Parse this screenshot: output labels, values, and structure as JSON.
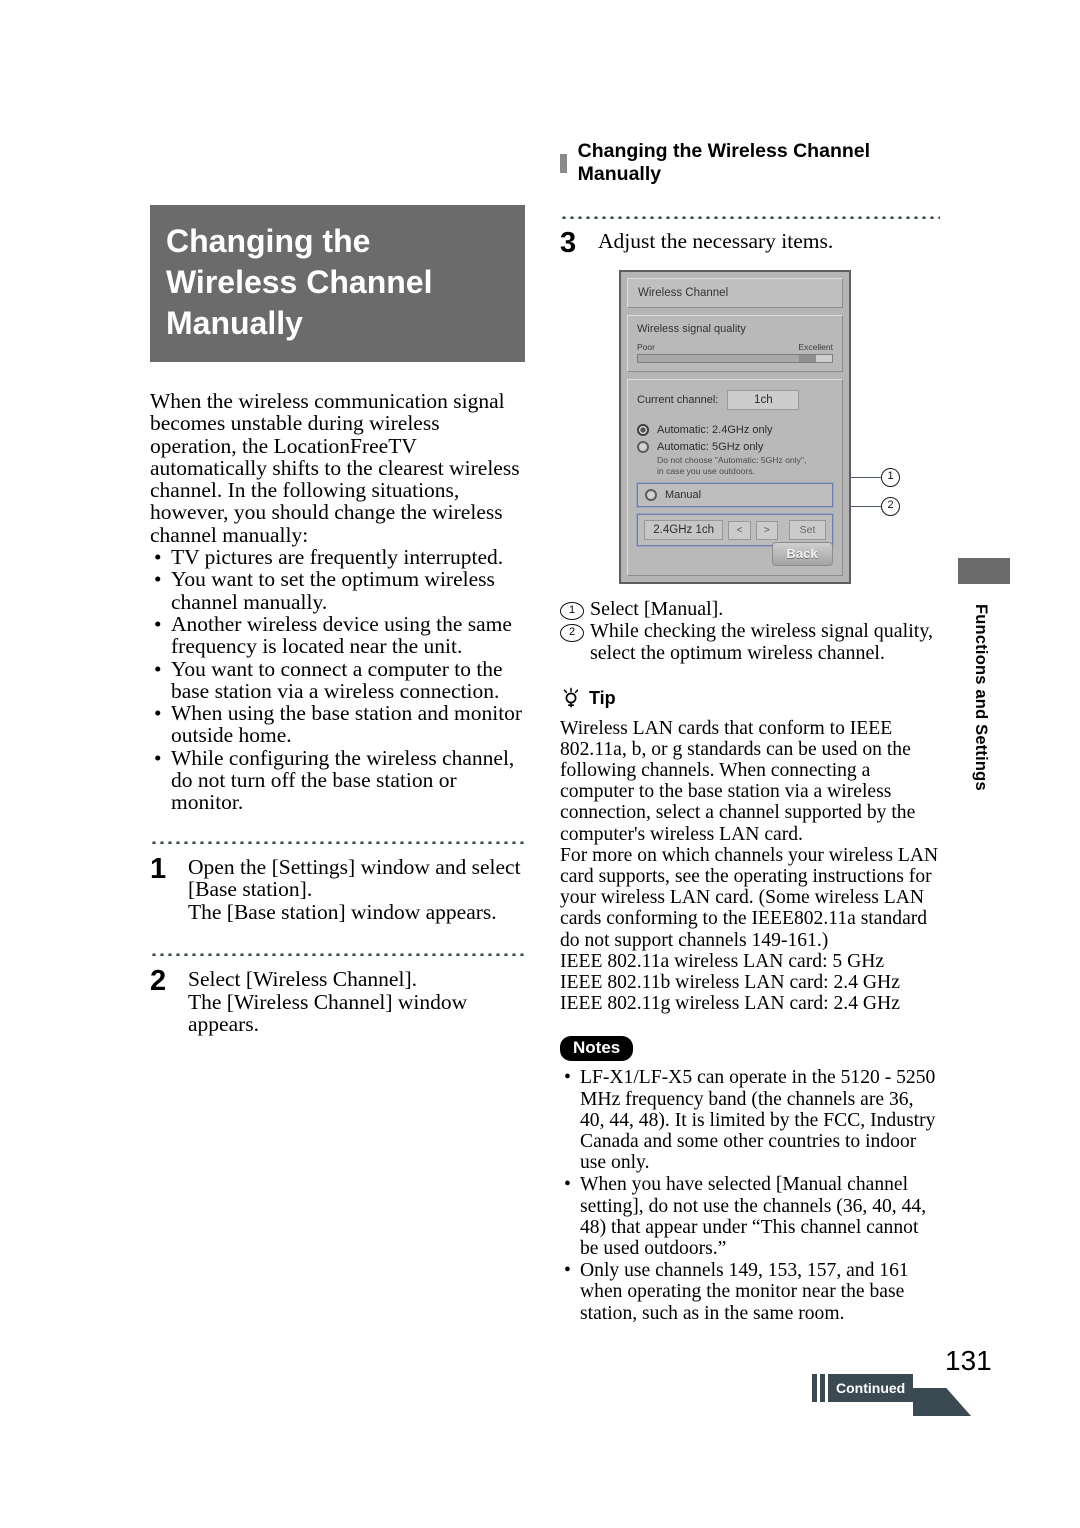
{
  "left": {
    "chapter_title": "Changing the Wireless Channel Manually",
    "intro_paragraph": "When the wireless communication signal becomes unstable during wireless operation, the LocationFreeTV automatically shifts to the clearest wireless channel. In the following situations, however, you should change the wireless channel manually:",
    "bullets": [
      "TV pictures are frequently interrupted.",
      "You want to set the optimum wireless channel manually.",
      "Another wireless device using the same frequency is located near the unit.",
      "You want to connect a computer to the base station via a wireless connection.",
      "When using the base station and monitor outside home.",
      "While configuring the wireless channel, do not turn off the base station or monitor."
    ],
    "steps": [
      {
        "number": "1",
        "text": "Open the [Settings] window and select [Base station].",
        "result": "The [Base station] window appears."
      },
      {
        "number": "2",
        "text": "Select [Wireless Channel].",
        "result": "The [Wireless Channel] window appears."
      }
    ]
  },
  "right": {
    "section_heading": "Changing the Wireless Channel Manually",
    "step3": {
      "number": "3",
      "text": "Adjust the necessary items."
    },
    "screen": {
      "title": "Wireless Channel",
      "signal_quality_label": "Wireless signal quality",
      "scale_low": "Poor",
      "scale_high": "Excellent",
      "signal_level_percent": 92,
      "current_channel_label": "Current channel:",
      "current_channel_value": "1ch",
      "radio_auto_24": "Automatic: 2.4GHz only",
      "radio_auto_5": "Automatic: 5GHz only",
      "radio_note_line1": "Do not choose \"Automatic: 5GHz only\",",
      "radio_note_line2": "in case you use outdoors.",
      "radio_manual": "Manual",
      "channel_value": "2.4GHz 1ch",
      "prev_label": "<",
      "next_label": ">",
      "set_label": "Set",
      "back_label": "Back",
      "callout_1": "1",
      "callout_2": "2"
    },
    "callout_items": [
      {
        "marker": "1",
        "text": "Select [Manual]."
      },
      {
        "marker": "2",
        "text": "While checking the wireless signal quality, select the optimum wireless channel."
      }
    ],
    "tip": {
      "heading": "Tip",
      "paragraphs": [
        "Wireless LAN cards that conform to IEEE 802.11a, b, or g standards can be used on the following channels. When connecting a computer to the base station via a wireless connection, select a channel supported by the computer's wireless LAN card.",
        "For more on which channels your wireless LAN card supports, see the operating instructions for your wireless LAN card. (Some wireless LAN cards conforming to the IEEE802.11a standard do not support channels 149-161.)",
        "IEEE 802.11a wireless LAN card: 5 GHz",
        "IEEE 802.11b wireless LAN card: 2.4 GHz",
        "IEEE 802.11g wireless LAN card: 2.4 GHz"
      ]
    },
    "notes": {
      "badge": "Notes",
      "items": [
        "LF-X1/LF-X5 can operate in the 5120 - 5250 MHz frequency band (the channels are 36, 40, 44, 48). It is limited by the FCC, Industry Canada and some other countries to indoor use only.",
        "When you have selected [Manual channel setting], do not use the channels (36, 40, 44, 48) that appear under “This channel cannot be used outdoors.”",
        "Only use channels 149, 153, 157, and 161 when operating the monitor near the base station, such as in the same room."
      ]
    }
  },
  "side_tab": {
    "label": "Functions and Settings"
  },
  "footer": {
    "page_number": "131",
    "continued_label": "Continued"
  },
  "colors": {
    "title_block_bg": "#6b6b6b",
    "dot_rule": "#3e4d54",
    "continued_bg": "#3b4a52",
    "screen_bg": "#b5b5b5",
    "callout_outline": "#6e7fa8"
  }
}
